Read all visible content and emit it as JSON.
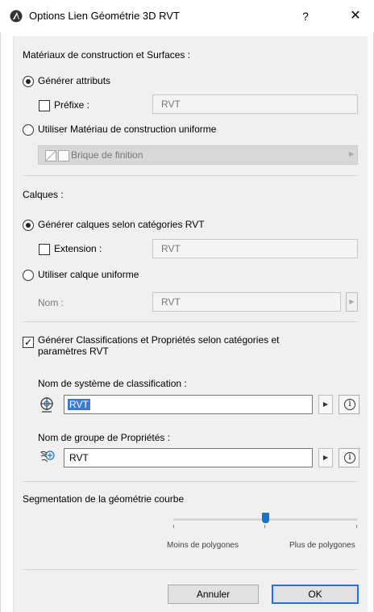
{
  "window": {
    "title": "Options Lien Géométrie 3D RVT",
    "help": "?",
    "close": "✕"
  },
  "materials": {
    "heading": "Matériaux de construction et Surfaces :",
    "generate_label": "Générer attributs",
    "prefix_label": "Préfixe :",
    "prefix_value": "RVT",
    "uniform_label": "Utiliser Matériau de construction uniforme",
    "material_name": "Brique de finition"
  },
  "layers": {
    "heading": "Calques :",
    "generate_label": "Générer calques selon catégories RVT",
    "extension_label": "Extension :",
    "extension_value": "RVT",
    "uniform_label": "Utiliser calque uniforme",
    "name_label": "Nom :",
    "name_value": "RVT"
  },
  "classification": {
    "generate_label_line1": "Générer Classifications et Propriétés selon catégories et",
    "generate_label_line2": "paramètres RVT",
    "system_label": "Nom de système de classification :",
    "system_value": "RVT",
    "group_label": "Nom de groupe de Propriétés :",
    "group_value": "RVT"
  },
  "segmentation": {
    "heading": "Segmentation de la géométrie courbe",
    "min_label": "Moins de polygones",
    "max_label": "Plus de polygones",
    "level": 0.5
  },
  "buttons": {
    "cancel": "Annuler",
    "ok": "OK"
  },
  "colors": {
    "accent": "#1e74d8",
    "panel_bg": "#f0f0f0"
  }
}
